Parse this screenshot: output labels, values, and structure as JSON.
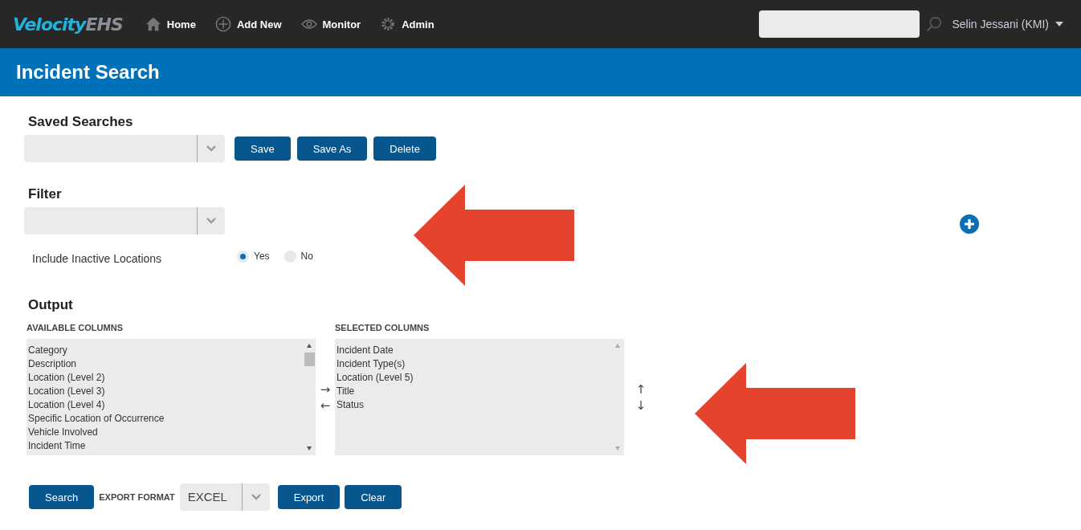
{
  "logo": {
    "primary": "Velocity",
    "secondary": "EHS"
  },
  "nav": [
    {
      "kind": "home",
      "label": "Home"
    },
    {
      "kind": "add",
      "label": "Add New"
    },
    {
      "kind": "monitor",
      "label": "Monitor"
    },
    {
      "kind": "admin",
      "label": "Admin"
    }
  ],
  "user": {
    "name": "Selin Jessani (KMI)"
  },
  "page_title": "Incident Search",
  "saved_searches": {
    "heading": "Saved Searches",
    "buttons": [
      "Save",
      "Save As",
      "Delete"
    ]
  },
  "filter": {
    "heading": "Filter",
    "option_label": "Include Inactive Locations",
    "options": [
      {
        "label": "Yes",
        "selected": true
      },
      {
        "label": "No",
        "selected": false
      }
    ]
  },
  "output": {
    "heading": "Output",
    "available_label": "AVAILABLE COLUMNS",
    "available": [
      "Category",
      "Description",
      "Location (Level 2)",
      "Location (Level 3)",
      "Location (Level 4)",
      "Specific Location of Occurrence",
      "Vehicle Involved",
      "Incident Time"
    ],
    "move_buttons": [
      "→",
      "←"
    ],
    "selected_label": "SELECTED COLUMNS",
    "selected": [
      "Incident Date",
      "Incident Type(s)",
      "Location (Level 5)",
      "Title",
      "Status"
    ],
    "order_buttons": [
      "↑",
      "↓"
    ]
  },
  "actions": {
    "search": "Search",
    "export_label": "EXPORT FORMAT",
    "export_format": "EXCEL",
    "export": "Export",
    "clear": "Clear"
  }
}
